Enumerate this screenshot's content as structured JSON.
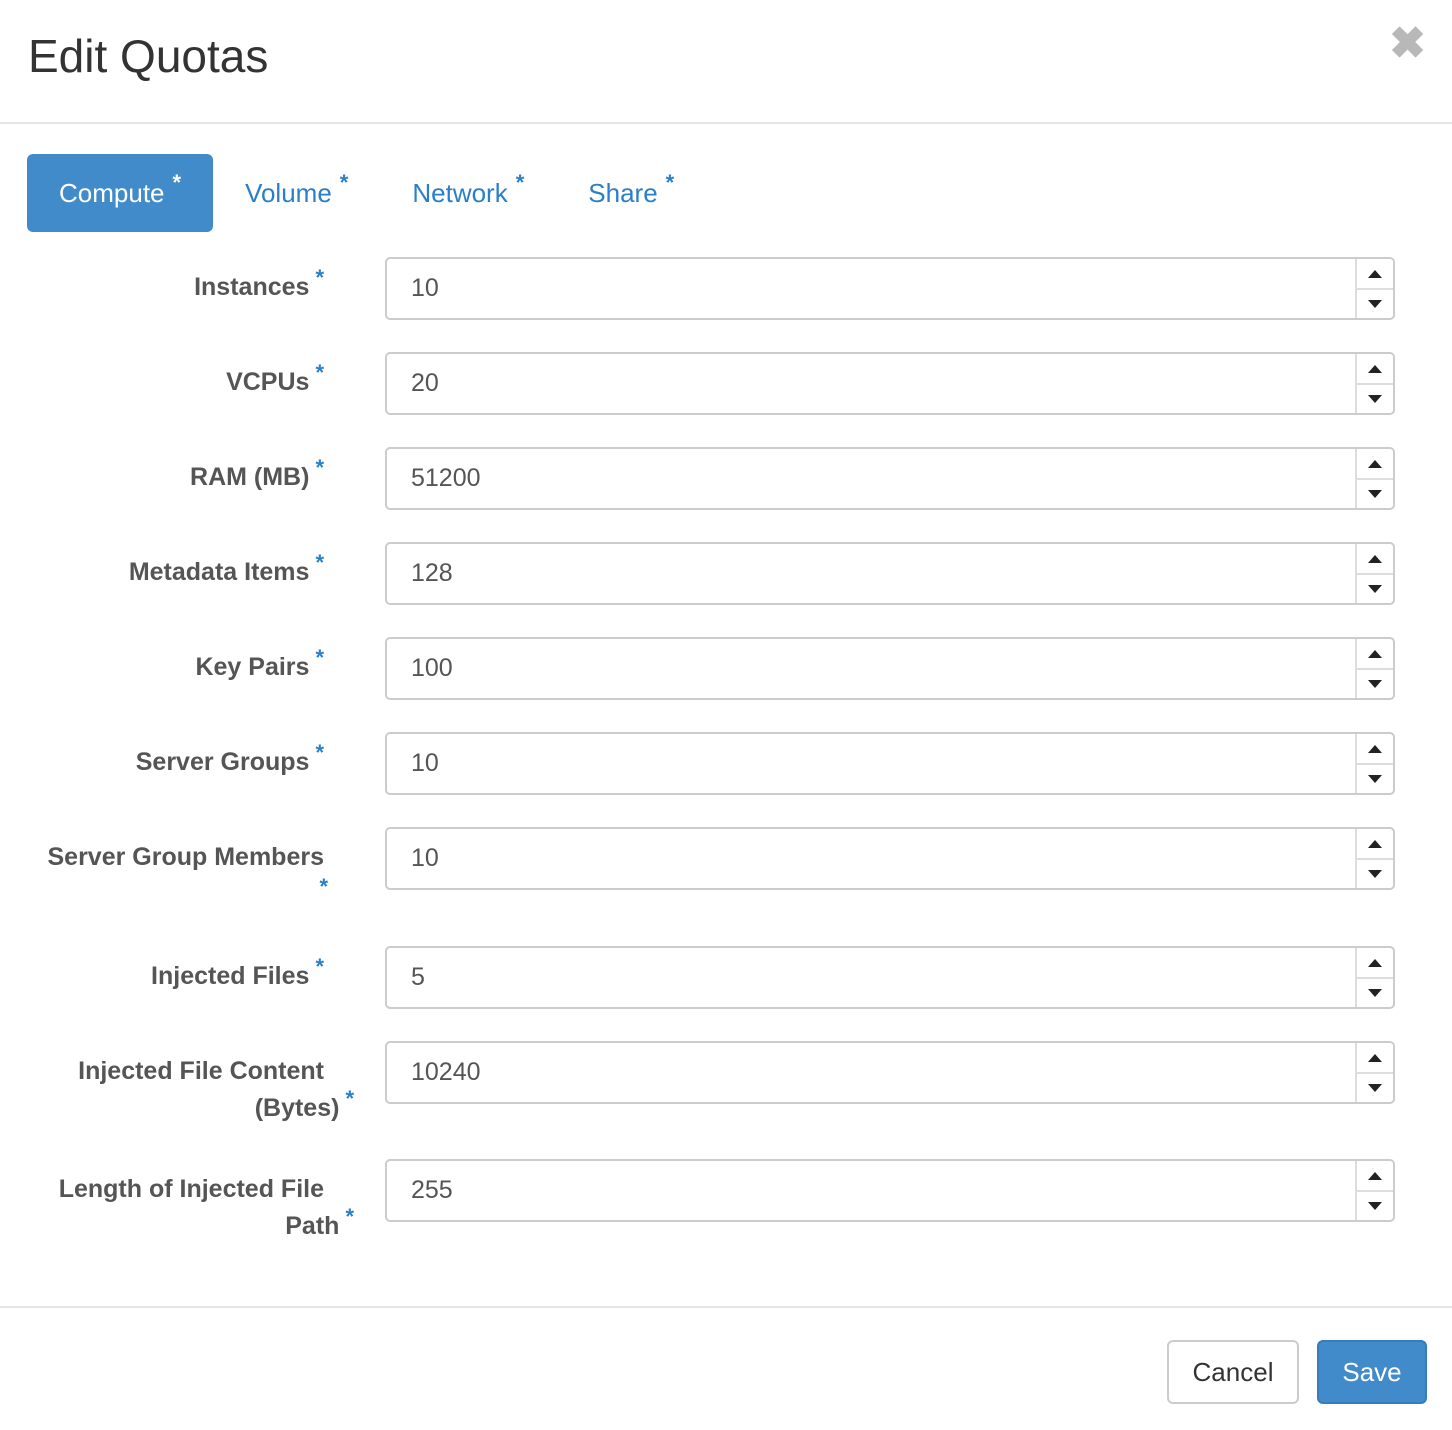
{
  "modal": {
    "title": "Edit Quotas",
    "close_glyph": "✖"
  },
  "tabs": [
    {
      "label": "Compute",
      "star": "*",
      "active": true
    },
    {
      "label": "Volume",
      "star": "*",
      "active": false
    },
    {
      "label": "Network",
      "star": "*",
      "active": false
    },
    {
      "label": "Share",
      "star": "*",
      "active": false
    }
  ],
  "fields": [
    {
      "label": "Instances",
      "value": "10",
      "required": "*"
    },
    {
      "label": "VCPUs",
      "value": "20",
      "required": "*"
    },
    {
      "label": "RAM (MB)",
      "value": "51200",
      "required": "*"
    },
    {
      "label": "Metadata Items",
      "value": "128",
      "required": "*"
    },
    {
      "label": "Key Pairs",
      "value": "100",
      "required": "*"
    },
    {
      "label": "Server Groups",
      "value": "10",
      "required": "*"
    },
    {
      "label": "Server Group Members",
      "value": "10",
      "required": "*"
    },
    {
      "label": "Injected Files",
      "value": "5",
      "required": "*"
    },
    {
      "label_line1": "Injected File Content",
      "label_line2": "(Bytes)",
      "value": "10240",
      "required": "*"
    },
    {
      "label_line1": "Length of Injected File",
      "label_line2": "Path",
      "value": "255",
      "required": "*"
    }
  ],
  "footer": {
    "cancel_label": "Cancel",
    "save_label": "Save"
  },
  "colors": {
    "primary": "#428bca",
    "link": "#2a7fc8",
    "label": "#555555"
  }
}
